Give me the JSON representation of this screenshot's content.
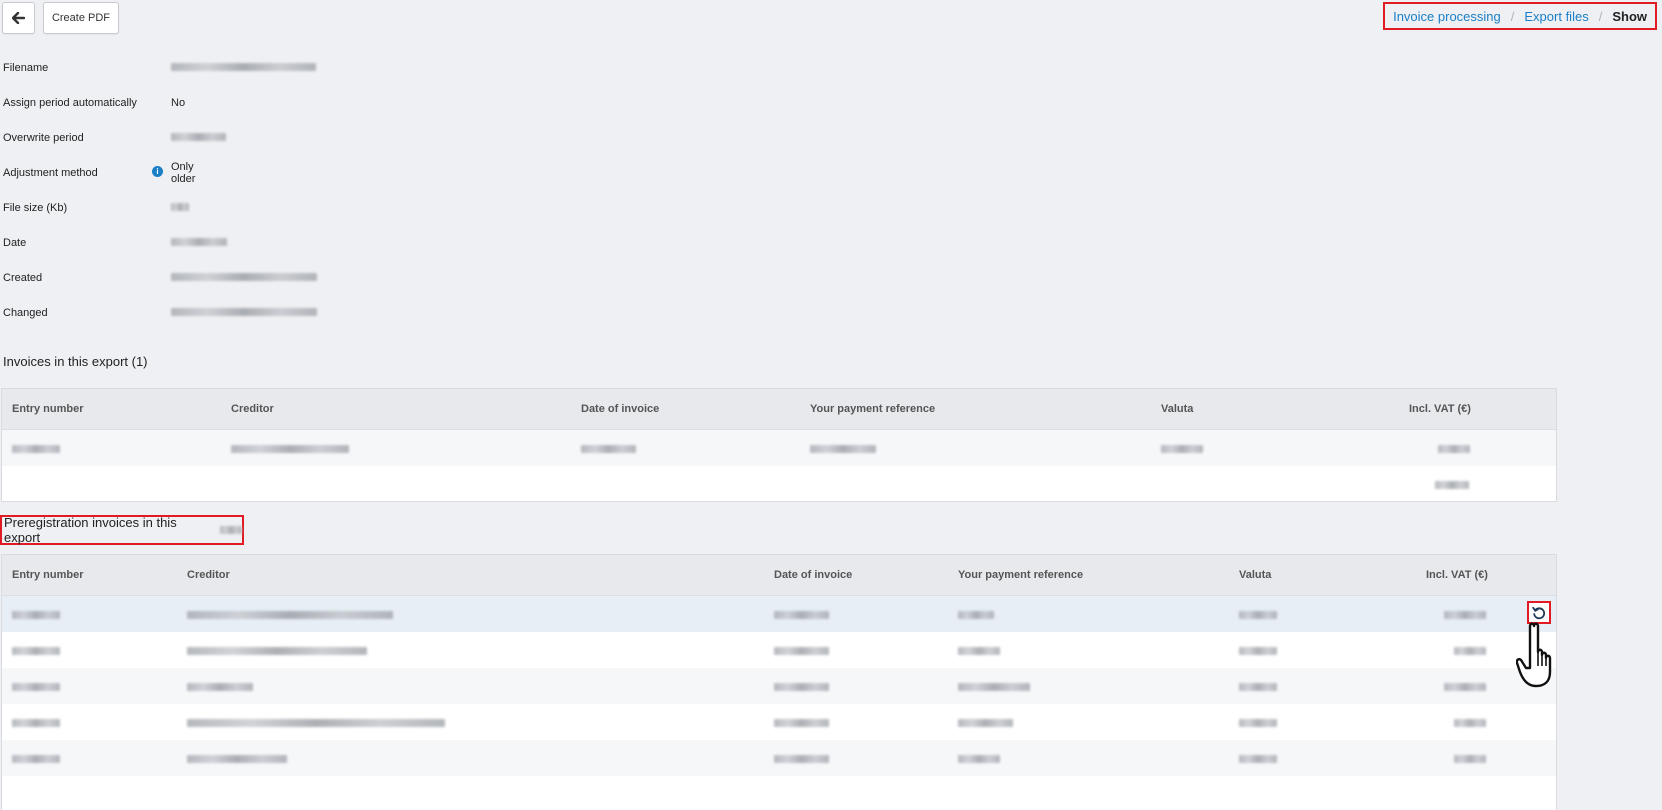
{
  "toolbar": {
    "back_icon": "arrow-left-icon",
    "create_pdf_label": "Create PDF"
  },
  "breadcrumb": {
    "items": [
      "Invoice processing",
      "Export files"
    ],
    "separator": "/",
    "current": "Show"
  },
  "details": {
    "filename_label": "Filename",
    "assign_period_label": "Assign period automatically",
    "assign_period_value": "No",
    "overwrite_period_label": "Overwrite period",
    "adjustment_method_label": "Adjustment method",
    "adjustment_method_value": "Only older",
    "file_size_label": "File size (Kb)",
    "date_label": "Date",
    "created_label": "Created",
    "changed_label": "Changed"
  },
  "invoices": {
    "title": "Invoices in this export (1)",
    "columns": [
      "Entry number",
      "Creditor",
      "Date of invoice",
      "Your payment reference",
      "Valuta",
      "Incl. VAT (€)"
    ]
  },
  "preregistration": {
    "title": "Preregistration invoices in this export",
    "columns": [
      "Entry number",
      "Creditor",
      "Date of invoice",
      "Your payment reference",
      "Valuta",
      "Incl. VAT (€)"
    ],
    "reload_icon": "reload-icon"
  },
  "colors": {
    "accent": "#1a7fc7",
    "highlight": "#e01b24",
    "background": "#eff0f3"
  }
}
